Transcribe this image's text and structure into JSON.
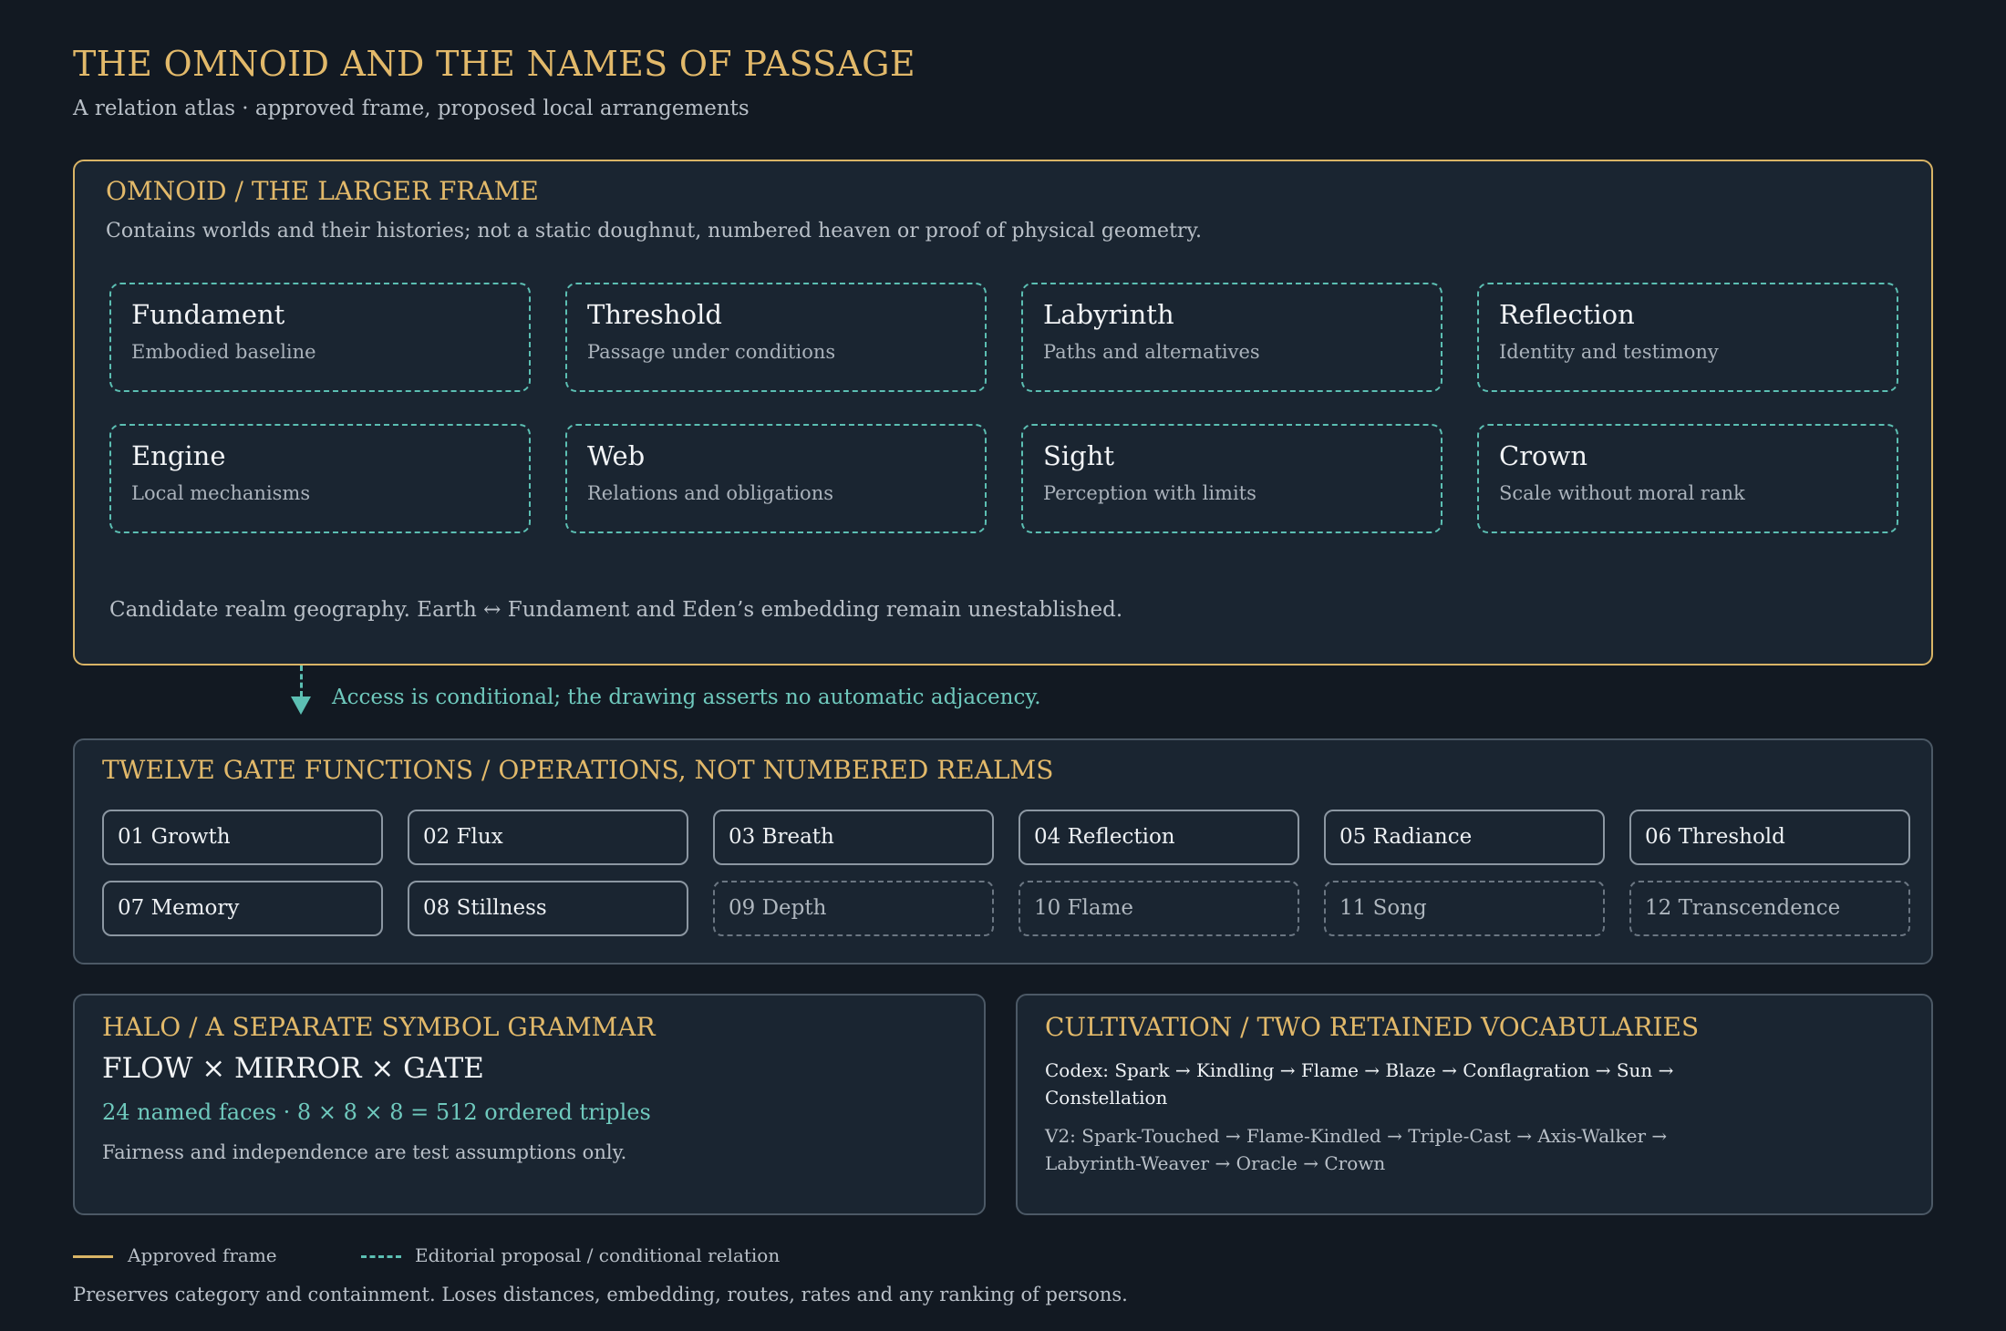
{
  "header": {
    "title": "THE OMNOID AND THE NAMES OF PASSAGE",
    "subtitle": "A relation atlas · approved frame, proposed local arrangements"
  },
  "omnoid": {
    "heading": "OMNOID / THE LARGER FRAME",
    "description": "Contains worlds and their histories; not a static doughnut, numbered heaven or proof of physical geometry.",
    "realms": [
      {
        "name": "Fundament",
        "desc": "Embodied baseline"
      },
      {
        "name": "Threshold",
        "desc": "Passage under conditions"
      },
      {
        "name": "Labyrinth",
        "desc": "Paths and alternatives"
      },
      {
        "name": "Reflection",
        "desc": "Identity and testimony"
      },
      {
        "name": "Engine",
        "desc": "Local mechanisms"
      },
      {
        "name": "Web",
        "desc": "Relations and obligations"
      },
      {
        "name": "Sight",
        "desc": "Perception with limits"
      },
      {
        "name": "Crown",
        "desc": "Scale without moral rank"
      }
    ],
    "note": "Candidate realm geography. Earth ↔ Fundament and Eden’s embedding remain unestablished."
  },
  "access": {
    "text": "Access is conditional; the drawing asserts no automatic adjacency."
  },
  "gates": {
    "heading": "TWELVE GATE FUNCTIONS / OPERATIONS, NOT NUMBERED REALMS",
    "items": [
      {
        "label": "01 Growth",
        "style": "solid"
      },
      {
        "label": "02 Flux",
        "style": "solid"
      },
      {
        "label": "03 Breath",
        "style": "solid"
      },
      {
        "label": "04 Reflection",
        "style": "solid"
      },
      {
        "label": "05 Radiance",
        "style": "solid"
      },
      {
        "label": "06 Threshold",
        "style": "solid"
      },
      {
        "label": "07 Memory",
        "style": "solid"
      },
      {
        "label": "08 Stillness",
        "style": "solid"
      },
      {
        "label": "09 Depth",
        "style": "dashed"
      },
      {
        "label": "10 Flame",
        "style": "dashed"
      },
      {
        "label": "11 Song",
        "style": "dashed"
      },
      {
        "label": "12 Transcendence",
        "style": "dashed"
      }
    ]
  },
  "halo": {
    "heading": "HALO / A SEPARATE SYMBOL GRAMMAR",
    "formula": "FLOW × MIRROR × GATE",
    "count": "24 named faces · 8 × 8 × 8 = 512 ordered triples",
    "note": "Fairness and independence are test assumptions only."
  },
  "cultivation": {
    "heading": "CULTIVATION / TWO RETAINED VOCABULARIES",
    "codex_line1": "Codex: Spark → Kindling → Flame → Blaze → Conflagration → Sun →",
    "codex_line2": "Constellation",
    "v2_line1": "V2: Spark-Touched → Flame-Kindled → Triple-Cast → Axis-Walker →",
    "v2_line2": "Labyrinth-Weaver → Oracle → Crown"
  },
  "legend": {
    "approved": "Approved frame",
    "proposal": "Editorial proposal / conditional relation"
  },
  "footer": "Preserves category and containment. Loses distances, embedding, routes, rates and any ranking of persons.",
  "colors": {
    "background": "#121922",
    "panel": "#1a2531",
    "gold": "#d9b466",
    "teal": "#5cbfb3"
  }
}
